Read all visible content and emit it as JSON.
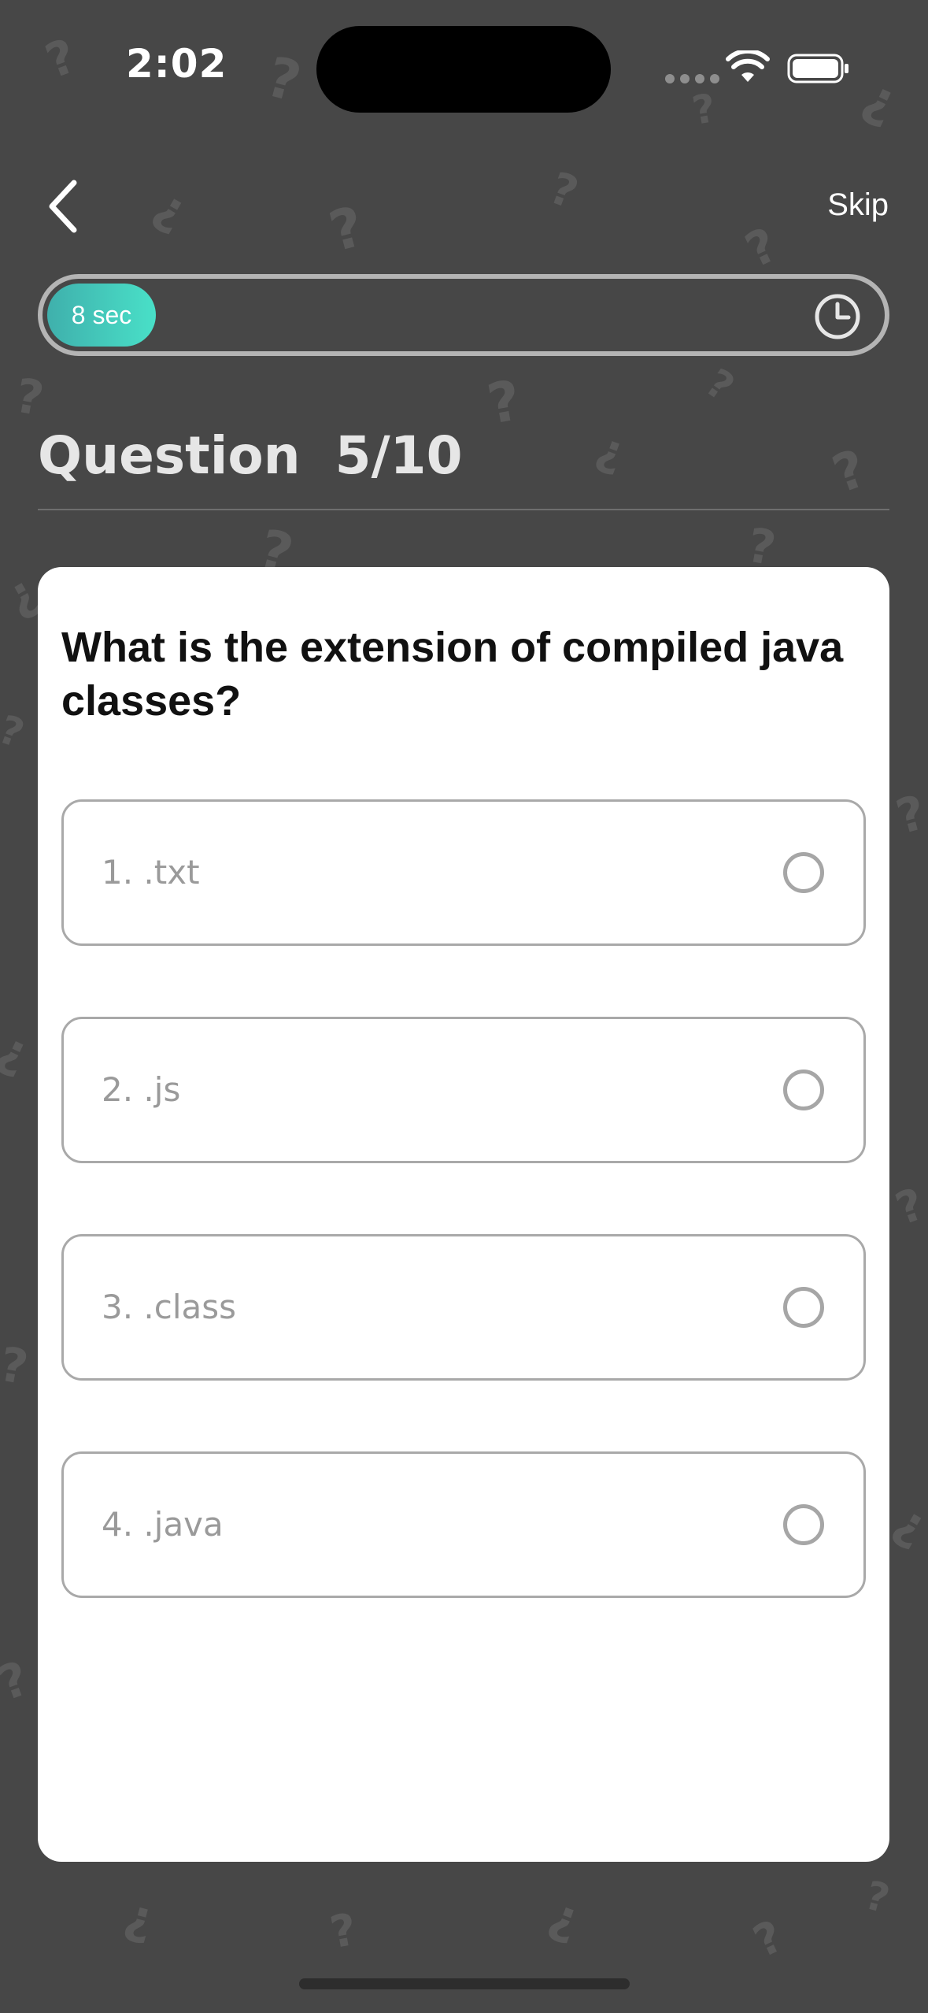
{
  "status_bar": {
    "time": "2:02"
  },
  "nav": {
    "back_icon": "chevron-left-icon",
    "skip_label": "Skip"
  },
  "timer": {
    "label": "8 sec",
    "remaining_fraction": 0.13,
    "icon": "clock-icon",
    "accent_start": "#3fb0ac",
    "accent_end": "#49e0c8"
  },
  "question_header": {
    "title": "Question",
    "counter": "5/10"
  },
  "question": {
    "text": "What is the extension of compiled java classes?",
    "options": [
      {
        "label": "1. .txt",
        "selected": false
      },
      {
        "label": "2. .js",
        "selected": false
      },
      {
        "label": "3. .class",
        "selected": false
      },
      {
        "label": "4. .java",
        "selected": false
      }
    ]
  },
  "colors": {
    "background": "#474747",
    "card": "#ffffff"
  }
}
